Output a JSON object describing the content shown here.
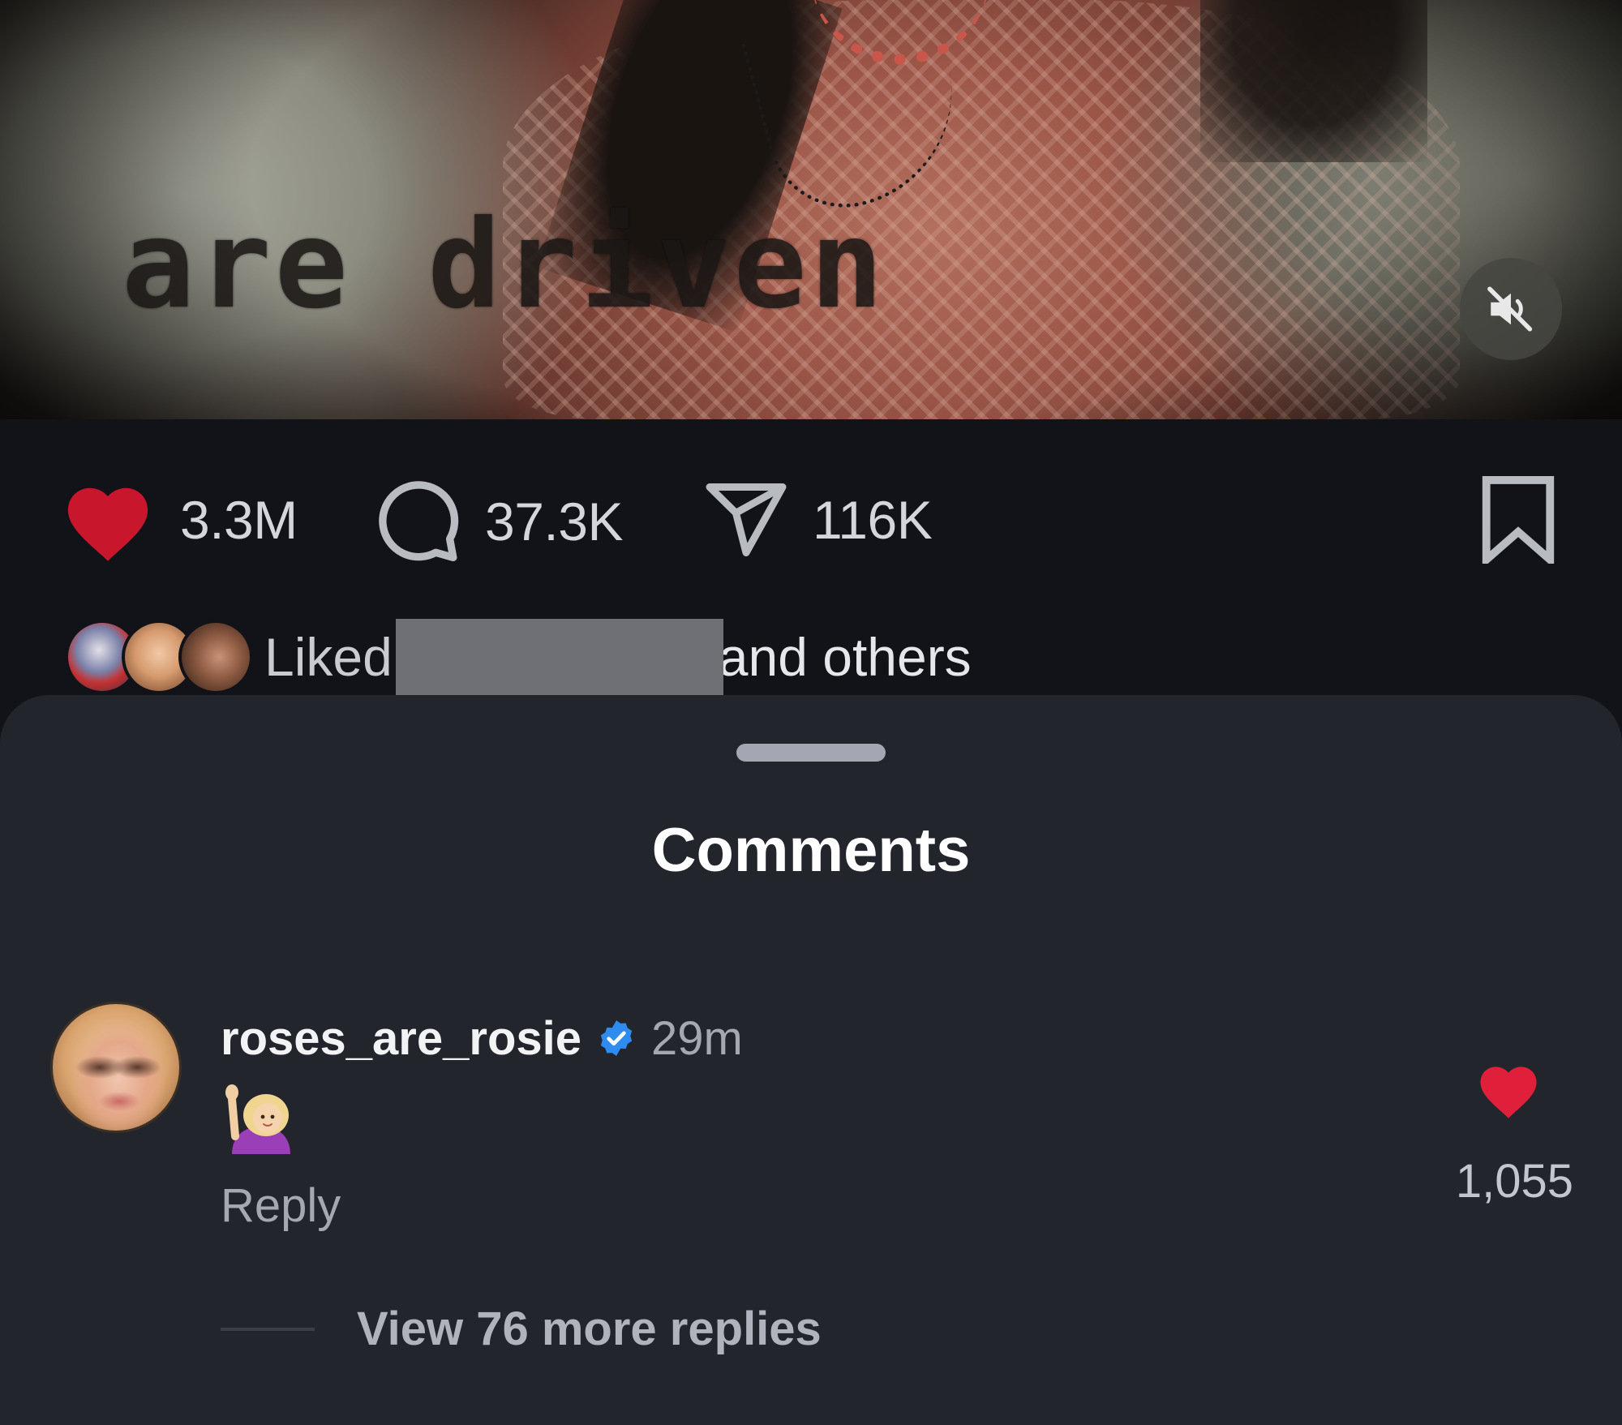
{
  "media": {
    "caption_text": "are driven",
    "mute_icon": "speaker-muted-icon"
  },
  "actions": {
    "like_icon": "heart-filled-icon",
    "like_count": "3.3M",
    "comment_icon": "comment-bubble-icon",
    "comment_count": "37.3K",
    "share_icon": "paper-plane-icon",
    "share_count": "116K",
    "save_icon": "bookmark-icon"
  },
  "liked_by": {
    "prefix": "Liked",
    "suffix": "and others"
  },
  "comments_sheet": {
    "title": "Comments",
    "comments": [
      {
        "username": "roses_are_rosie",
        "verified": true,
        "time": "29m",
        "text_emoji": "🙋🏼‍♀️",
        "reply_label": "Reply",
        "like_count": "1,055",
        "view_replies": "View 76 more replies"
      }
    ]
  },
  "colors": {
    "background": "#111318",
    "sheet": "#23252d",
    "like_red": "#e0203a",
    "verified_blue": "#2e8bf0"
  }
}
